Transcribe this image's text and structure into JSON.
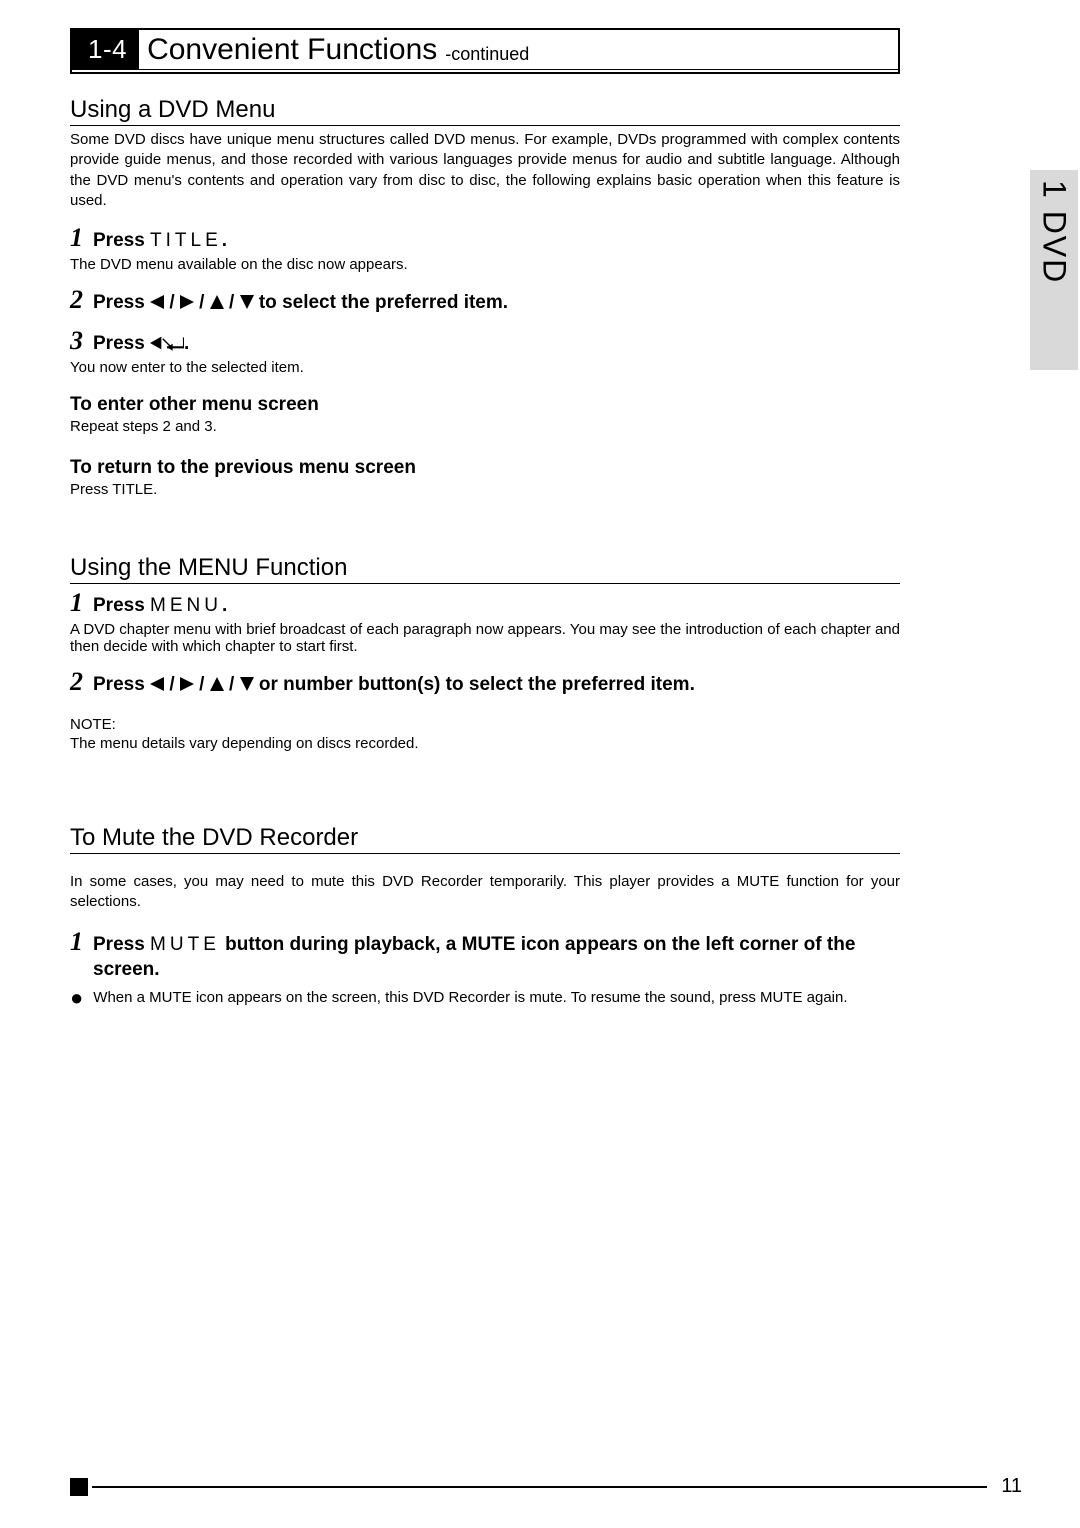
{
  "header": {
    "section_number": "1-4",
    "title": "Convenient Functions",
    "continued": "-continued"
  },
  "side_tab": "1 DVD",
  "s1": {
    "heading": "Using a DVD Menu",
    "intro": "Some DVD discs have unique menu structures called DVD menus. For example, DVDs programmed with complex contents provide guide menus, and those recorded with various languages provide menus for audio and subtitle language. Although the DVD menu's contents and operation vary from disc to disc, the following explains basic operation when this feature is used.",
    "step1_num": "1",
    "step1_press": "Press ",
    "step1_btn": "TITLE",
    "step1_period": ".",
    "step1_desc": "The DVD menu available on the disc now appears.",
    "step2_num": "2",
    "step2_press": "Press ",
    "step2_tail": " to select the preferred item.",
    "step3_num": "3",
    "step3_press": "Press ",
    "step3_period": ".",
    "step3_desc": "You now enter to the selected item.",
    "sub1_h": "To enter other menu screen",
    "sub1_d": "Repeat steps 2 and 3.",
    "sub2_h": "To return to the previous menu screen",
    "sub2_d": "Press TITLE."
  },
  "s2": {
    "heading": "Using the MENU Function",
    "step1_num": "1",
    "step1_press": "Press ",
    "step1_btn": "MENU",
    "step1_period": ".",
    "step1_desc": "A DVD chapter menu with brief broadcast of each paragraph now appears. You may see the introduction of each chapter and then decide with which chapter to start first.",
    "step2_num": "2",
    "step2_press": "Press ",
    "step2_tail": " or number button(s) to select the preferred item.",
    "note_label": "NOTE:",
    "note_body": "The menu details vary depending on discs recorded."
  },
  "s3": {
    "heading": "To Mute the DVD Recorder",
    "intro": "In some cases, you may need to mute this DVD Recorder temporarily. This player provides a MUTE function for your selections.",
    "step1_num": "1",
    "step1_press": "Press ",
    "step1_btn": "MUTE",
    "step1_tail": " button during playback, a MUTE icon appears on the left corner of the screen.",
    "bullet": "When a MUTE icon appears on the screen, this DVD Recorder is mute. To resume the sound, press MUTE again."
  },
  "page_number": "11"
}
